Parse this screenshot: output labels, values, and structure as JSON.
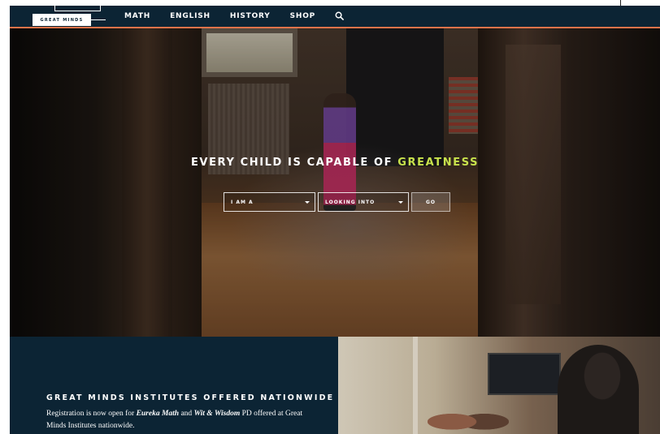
{
  "brand": {
    "logo_text": "GREAT MINDS"
  },
  "nav": {
    "items": [
      {
        "label": "MATH"
      },
      {
        "label": "ENGLISH"
      },
      {
        "label": "HISTORY"
      },
      {
        "label": "SHOP"
      }
    ],
    "search_icon": "search-icon"
  },
  "hero": {
    "headline_main": "EVERY CHILD IS CAPABLE OF ",
    "headline_accent": "GREATNESS",
    "accent_color": "#c8e24c",
    "select_role": "I AM A",
    "select_topic": "LOOKING INTO",
    "go_label": "GO"
  },
  "institutes": {
    "title": "GREAT MINDS INSTITUTES OFFERED NATIONWIDE",
    "body_prefix": "Registration is now open for ",
    "body_em1": "Eureka Math",
    "body_mid": " and ",
    "body_em2": "Wit & Wisdom",
    "body_suffix": " PD offered at Great Minds Institutes nationwide."
  },
  "colors": {
    "navy": "#0c2434",
    "accent_orange": "#e2734a"
  }
}
